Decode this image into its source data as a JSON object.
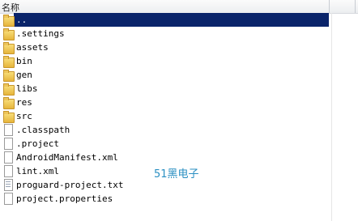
{
  "header": {
    "name_column": "名称"
  },
  "files": [
    {
      "name": "..",
      "icon": "folder-icon",
      "selected": true
    },
    {
      "name": ".settings",
      "icon": "folder-icon"
    },
    {
      "name": "assets",
      "icon": "folder-icon"
    },
    {
      "name": "bin",
      "icon": "folder-icon"
    },
    {
      "name": "gen",
      "icon": "folder-icon"
    },
    {
      "name": "libs",
      "icon": "folder-icon"
    },
    {
      "name": "res",
      "icon": "folder-icon"
    },
    {
      "name": "src",
      "icon": "folder-icon"
    },
    {
      "name": ".classpath",
      "icon": "file-icon"
    },
    {
      "name": ".project",
      "icon": "file-icon"
    },
    {
      "name": "AndroidManifest.xml",
      "icon": "file-icon"
    },
    {
      "name": "lint.xml",
      "icon": "file-icon"
    },
    {
      "name": "proguard-project.txt",
      "icon": "text-file-icon"
    },
    {
      "name": "project.properties",
      "icon": "file-icon"
    }
  ],
  "watermark": "51黑电子",
  "colors": {
    "selection": "#0a246a",
    "watermark": "#2a8fc2"
  }
}
